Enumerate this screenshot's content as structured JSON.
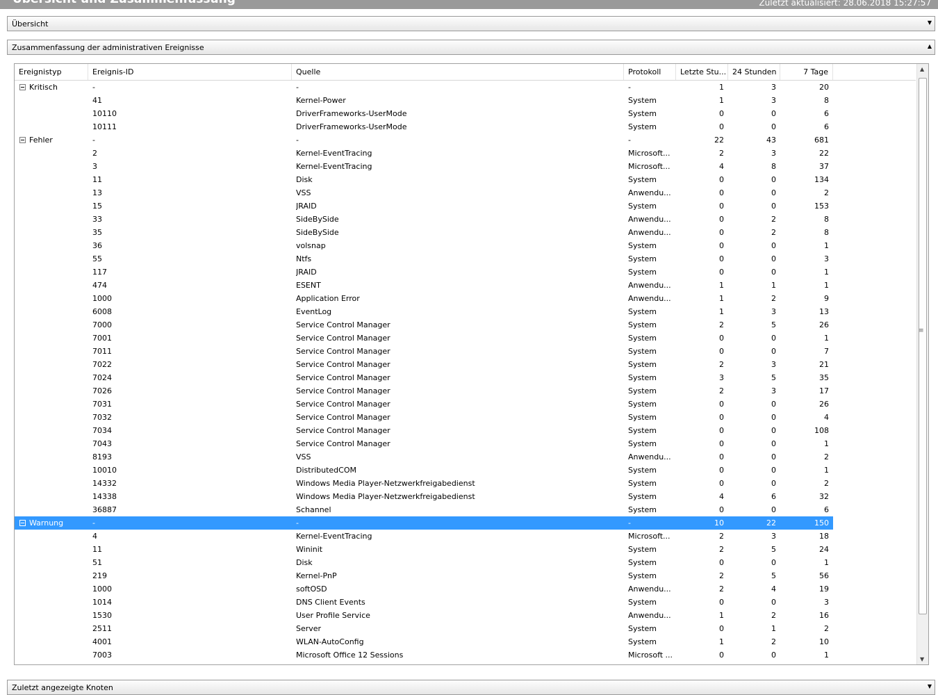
{
  "window": {
    "title": "Übersicht und Zusammenfassung",
    "last_updated": "Zuletzt aktualisiert: 28.06.2018 15:27:57"
  },
  "sections": {
    "overview": "Übersicht",
    "admin_events": "Zusammenfassung der administrativen Ereignisse",
    "recent_nodes": "Zuletzt angezeigte Knoten"
  },
  "columns": [
    "Ereignistyp",
    "Ereignis-ID",
    "Quelle",
    "Protokoll",
    "Letzte Stu...",
    "24 Stunden",
    "7 Tage"
  ],
  "rows": [
    {
      "group": true,
      "type": "Kritisch",
      "id": "-",
      "src": "-",
      "prot": "-",
      "h": "1",
      "d": "3",
      "w": "20"
    },
    {
      "id": "41",
      "src": "Kernel-Power",
      "prot": "System",
      "h": "1",
      "d": "3",
      "w": "8"
    },
    {
      "id": "10110",
      "src": "DriverFrameworks-UserMode",
      "prot": "System",
      "h": "0",
      "d": "0",
      "w": "6"
    },
    {
      "id": "10111",
      "src": "DriverFrameworks-UserMode",
      "prot": "System",
      "h": "0",
      "d": "0",
      "w": "6"
    },
    {
      "group": true,
      "type": "Fehler",
      "id": "-",
      "src": "-",
      "prot": "-",
      "h": "22",
      "d": "43",
      "w": "681"
    },
    {
      "id": "2",
      "src": "Kernel-EventTracing",
      "prot": "Microsoft...",
      "h": "2",
      "d": "3",
      "w": "22"
    },
    {
      "id": "3",
      "src": "Kernel-EventTracing",
      "prot": "Microsoft...",
      "h": "4",
      "d": "8",
      "w": "37"
    },
    {
      "id": "11",
      "src": "Disk",
      "prot": "System",
      "h": "0",
      "d": "0",
      "w": "134"
    },
    {
      "id": "13",
      "src": "VSS",
      "prot": "Anwendu...",
      "h": "0",
      "d": "0",
      "w": "2"
    },
    {
      "id": "15",
      "src": "JRAID",
      "prot": "System",
      "h": "0",
      "d": "0",
      "w": "153"
    },
    {
      "id": "33",
      "src": "SideBySide",
      "prot": "Anwendu...",
      "h": "0",
      "d": "2",
      "w": "8"
    },
    {
      "id": "35",
      "src": "SideBySide",
      "prot": "Anwendu...",
      "h": "0",
      "d": "2",
      "w": "8"
    },
    {
      "id": "36",
      "src": "volsnap",
      "prot": "System",
      "h": "0",
      "d": "0",
      "w": "1"
    },
    {
      "id": "55",
      "src": "Ntfs",
      "prot": "System",
      "h": "0",
      "d": "0",
      "w": "3"
    },
    {
      "id": "117",
      "src": "JRAID",
      "prot": "System",
      "h": "0",
      "d": "0",
      "w": "1"
    },
    {
      "id": "474",
      "src": "ESENT",
      "prot": "Anwendu...",
      "h": "1",
      "d": "1",
      "w": "1"
    },
    {
      "id": "1000",
      "src": "Application Error",
      "prot": "Anwendu...",
      "h": "1",
      "d": "2",
      "w": "9"
    },
    {
      "id": "6008",
      "src": "EventLog",
      "prot": "System",
      "h": "1",
      "d": "3",
      "w": "13"
    },
    {
      "id": "7000",
      "src": "Service Control Manager",
      "prot": "System",
      "h": "2",
      "d": "5",
      "w": "26"
    },
    {
      "id": "7001",
      "src": "Service Control Manager",
      "prot": "System",
      "h": "0",
      "d": "0",
      "w": "1"
    },
    {
      "id": "7011",
      "src": "Service Control Manager",
      "prot": "System",
      "h": "0",
      "d": "0",
      "w": "7"
    },
    {
      "id": "7022",
      "src": "Service Control Manager",
      "prot": "System",
      "h": "2",
      "d": "3",
      "w": "21"
    },
    {
      "id": "7024",
      "src": "Service Control Manager",
      "prot": "System",
      "h": "3",
      "d": "5",
      "w": "35"
    },
    {
      "id": "7026",
      "src": "Service Control Manager",
      "prot": "System",
      "h": "2",
      "d": "3",
      "w": "17"
    },
    {
      "id": "7031",
      "src": "Service Control Manager",
      "prot": "System",
      "h": "0",
      "d": "0",
      "w": "26"
    },
    {
      "id": "7032",
      "src": "Service Control Manager",
      "prot": "System",
      "h": "0",
      "d": "0",
      "w": "4"
    },
    {
      "id": "7034",
      "src": "Service Control Manager",
      "prot": "System",
      "h": "0",
      "d": "0",
      "w": "108"
    },
    {
      "id": "7043",
      "src": "Service Control Manager",
      "prot": "System",
      "h": "0",
      "d": "0",
      "w": "1"
    },
    {
      "id": "8193",
      "src": "VSS",
      "prot": "Anwendu...",
      "h": "0",
      "d": "0",
      "w": "2"
    },
    {
      "id": "10010",
      "src": "DistributedCOM",
      "prot": "System",
      "h": "0",
      "d": "0",
      "w": "1"
    },
    {
      "id": "14332",
      "src": "Windows Media Player-Netzwerkfreigabedienst",
      "prot": "System",
      "h": "0",
      "d": "0",
      "w": "2"
    },
    {
      "id": "14338",
      "src": "Windows Media Player-Netzwerkfreigabedienst",
      "prot": "System",
      "h": "4",
      "d": "6",
      "w": "32"
    },
    {
      "id": "36887",
      "src": "Schannel",
      "prot": "System",
      "h": "0",
      "d": "0",
      "w": "6"
    },
    {
      "group": true,
      "selected": true,
      "type": "Warnung",
      "id": "-",
      "src": "-",
      "prot": "-",
      "h": "10",
      "d": "22",
      "w": "150"
    },
    {
      "id": "4",
      "src": "Kernel-EventTracing",
      "prot": "Microsoft...",
      "h": "2",
      "d": "3",
      "w": "18"
    },
    {
      "id": "11",
      "src": "Wininit",
      "prot": "System",
      "h": "2",
      "d": "5",
      "w": "24"
    },
    {
      "id": "51",
      "src": "Disk",
      "prot": "System",
      "h": "0",
      "d": "0",
      "w": "1"
    },
    {
      "id": "219",
      "src": "Kernel-PnP",
      "prot": "System",
      "h": "2",
      "d": "5",
      "w": "56"
    },
    {
      "id": "1000",
      "src": "softOSD",
      "prot": "Anwendu...",
      "h": "2",
      "d": "4",
      "w": "19"
    },
    {
      "id": "1014",
      "src": "DNS Client Events",
      "prot": "System",
      "h": "0",
      "d": "0",
      "w": "3"
    },
    {
      "id": "1530",
      "src": "User Profile Service",
      "prot": "Anwendu...",
      "h": "1",
      "d": "2",
      "w": "16"
    },
    {
      "id": "2511",
      "src": "Server",
      "prot": "System",
      "h": "0",
      "d": "1",
      "w": "2"
    },
    {
      "id": "4001",
      "src": "WLAN-AutoConfig",
      "prot": "System",
      "h": "1",
      "d": "2",
      "w": "10"
    },
    {
      "id": "7003",
      "src": "Microsoft Office 12 Sessions",
      "prot": "Microsoft ...",
      "h": "0",
      "d": "0",
      "w": "1"
    }
  ],
  "icons": {
    "collapse": "minus-box-icon",
    "section_expanded": "chevron-up-icon",
    "section_collapsed": "chevron-down-icon"
  }
}
